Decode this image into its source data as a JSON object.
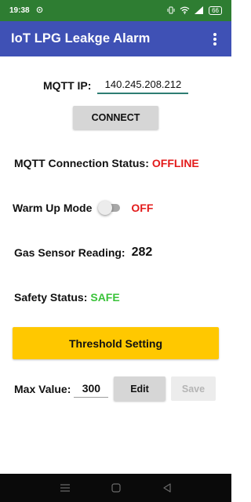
{
  "status_bar": {
    "time": "19:38",
    "battery": "66"
  },
  "app_bar": {
    "title": "IoT LPG Leakge Alarm"
  },
  "mqtt": {
    "ip_label": "MQTT IP:",
    "ip_value": "140.245.208.212",
    "connect_label": "CONNECT"
  },
  "connection": {
    "label": "MQTT Connection Status:",
    "status": "OFFLINE"
  },
  "warm_up": {
    "label": "Warm Up Mode",
    "state": "OFF"
  },
  "gas": {
    "label": "Gas Sensor Reading:",
    "value": "282"
  },
  "safety": {
    "label": "Safety Status:",
    "status": "SAFE"
  },
  "threshold": {
    "button_label": "Threshold Setting",
    "max_label": "Max Value:",
    "max_value": "300",
    "edit_label": "Edit",
    "save_label": "Save"
  },
  "colors": {
    "status_bar": "#2e7d32",
    "app_bar": "#3f51b5",
    "offline": "#e31b1b",
    "safe": "#3ac33a",
    "threshold_button": "#ffc800"
  },
  "icons": {
    "status_bar": [
      "sync-icon",
      "vibrate-icon",
      "wifi-icon",
      "signal-icon",
      "battery-icon"
    ],
    "menu": "more-vert-icon",
    "nav": [
      "recent-apps-icon",
      "home-icon",
      "back-icon"
    ]
  }
}
